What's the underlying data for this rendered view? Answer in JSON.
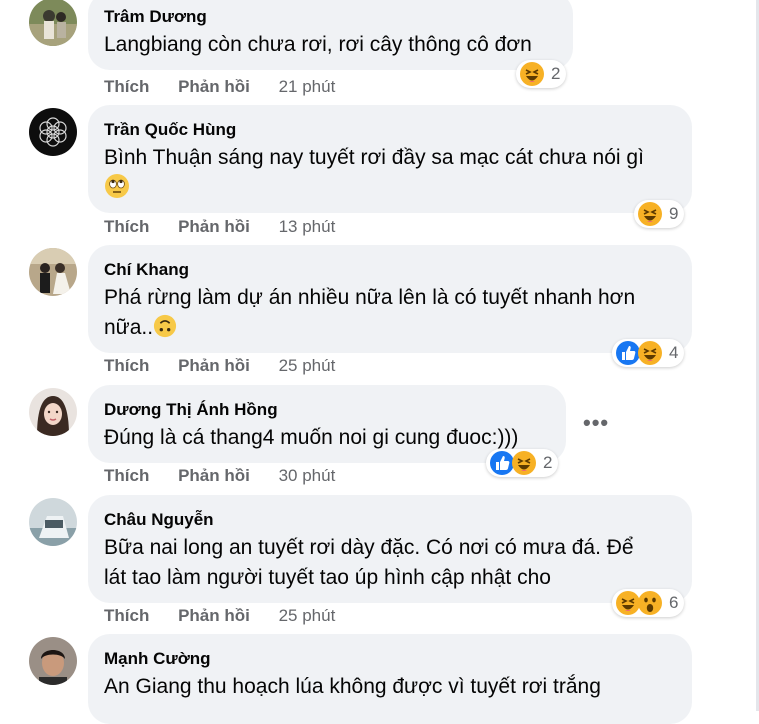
{
  "actions": {
    "like": "Thích",
    "reply": "Phản hồi"
  },
  "comments": [
    {
      "author": "Trâm Dương",
      "text": "Langbiang còn chưa rơi, rơi cây thông cô đơn",
      "time": "21 phút",
      "reactions": [
        "haha"
      ],
      "count": "2"
    },
    {
      "author": "Trần Quốc Hùng",
      "text": "Bình Thuận sáng nay tuyết rơi đầy sa mạc cát chưa nói gì",
      "emoji": "rolling-eyes",
      "time": "13 phút",
      "reactions": [
        "haha"
      ],
      "count": "9"
    },
    {
      "author": "Chí Khang",
      "text": "Phá rừng làm dự án nhiều nữa lên là có tuyết nhanh hơn\nnữa..",
      "emoji": "upside-down",
      "time": "25 phút",
      "reactions": [
        "like",
        "haha"
      ],
      "count": "4"
    },
    {
      "author": "Dương Thị Ánh Hồng",
      "text": "Đúng là cá thang4 muốn noi gi cung đuoc:)))",
      "time": "30 phút",
      "reactions": [
        "like",
        "haha"
      ],
      "count": "2",
      "more": "•••"
    },
    {
      "author": "Châu Nguyễn",
      "text": "Bữa nai long an tuyết rơi dày đặc. Có nơi có mưa đá. Để\nlát tao làm người tuyết tao úp hình cập nhật cho",
      "time": "25 phút",
      "reactions": [
        "haha",
        "wow"
      ],
      "count": "6"
    },
    {
      "author": "Mạnh Cường",
      "text": "An Giang thu hoạch lúa không được vì tuyết rơi trắng"
    }
  ]
}
